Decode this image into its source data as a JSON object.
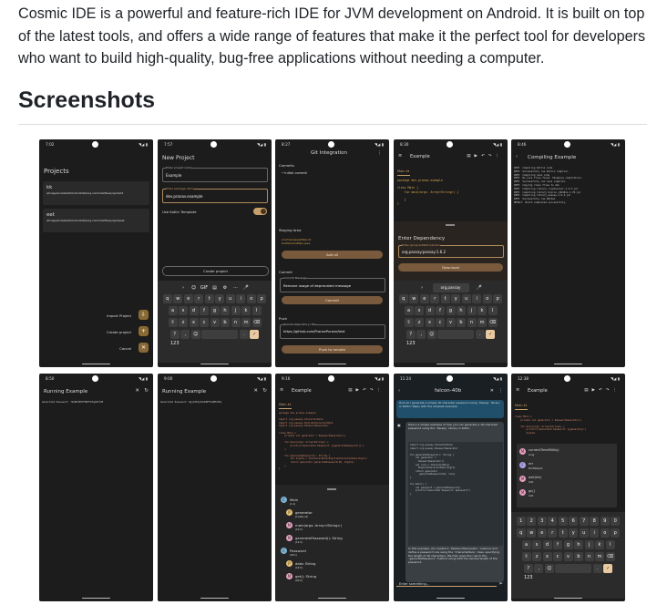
{
  "intro": "Cosmic IDE is a powerful and feature-rich IDE for JVM development on Android. It is built on top of the latest tools, and offers a wide range of features that make it the perfect tool for developers who want to build high-quality, bug-free applications without needing a computer.",
  "section_title": "Screenshots",
  "colors": {
    "accent": "#b08a5a",
    "dark": "#1c1c1c"
  },
  "icons": {
    "signal": "◥◢ ▮"
  },
  "shots": [
    {
      "time": "7:02",
      "title": "Projects",
      "projects": [
        {
          "name": "kk",
          "path": "/storage/emulated/0/Android/data/org.cosmicide/files/projects/kk"
        },
        {
          "name": "eet",
          "path": "/storage/emulated/0/Android/data/org.cosmicide/files/projects/eet"
        }
      ],
      "actions": [
        "Import Project",
        "Create project",
        "Cancel"
      ]
    },
    {
      "time": "7:57",
      "title": "New Project",
      "name_label": "Enter project name",
      "name_value": "Example",
      "pkg_label": "Enter package name",
      "pkg_value": "dev.pranav.example",
      "kotlin_label": "Use Kotlin Template",
      "create_label": "Create project"
    },
    {
      "time": "8:27",
      "title": "Git Integration",
      "commits_label": "Commits",
      "commit_item": "• Initial commit",
      "staging_label": "Staging Area",
      "staging_files": "src/main/java/Main.kt\nbuild/main/Main.java",
      "add_all": "Add all",
      "commit_label": "Commit",
      "commit_msg_label": "Commit Message",
      "commit_msg": "Remove usage of deprecated message",
      "commit_btn": "Commit",
      "push_label": "Push",
      "remote_label": "Remote Repository URL",
      "remote_url": "https://github.com/PranavPurwar/test",
      "push_btn": "Push to remote"
    },
    {
      "time": "8:30",
      "title": "Example",
      "tab": "Main.kt",
      "dep_title": "Enter Dependency",
      "dep_label": "Enter group:artifact:version",
      "dep_value": "org.passay:passay:1.6.2",
      "download": "Download",
      "suggestion": "org.passay"
    },
    {
      "time": "8:46",
      "title": "Compiling Example",
      "log": "INFO  Compiling Kotlin code\nINFO  Successfully ran Kotlin compiler.\nINFO  Compiling Java code\nINFO  No java files found. Skipping compilation.\nINFO  Successfully ran Java compiler.\nINFO  Copying class files to dex\nINFO  Compiling library cryptacular-1.2.5.jar\nINFO  Compiling library bcprov-jdk18on-1.76.jar\nINFO  Compiling library passay-1.6.2.jar\nINFO  Successfully ran D8/dex\nRESULT  Build completed successfully."
    },
    {
      "time": "8:50",
      "title": "Running Example",
      "output": "Generated Password: 7b4HhhE87F6M7FkFgmU7C9E"
    },
    {
      "time": "9:00",
      "title": "Running Example",
      "output": "Generated Password: Dgjh2XVyG4nbBF5Tq8Mc85q"
    },
    {
      "time": "9:16",
      "title": "Example",
      "tab": "Main.kt",
      "code": "package dev.pranav.example\n\nimport org.passay.CharacterRule\nimport org.passay.EnglishCharacterData\nimport org.passay.PasswordGenerator\n\nclass Main {\n    private val generator = PasswordGenerator()\n\n    fun main(args: Array<String>) {\n        println(\"Generated Password: ${generatePassword()}\")\n    }\n\n    fun generatePassword(): String {\n        val digits = CharacterRule(EnglishCharacterData.Digit)\n        return generator.generatePassword(20, digits)\n    }\n}",
      "outline": [
        {
          "kind": "C",
          "name": "Main",
          "line": "(1:1)"
        },
        {
          "kind": "P",
          "name": "generator",
          "line": "private val"
        },
        {
          "kind": "M",
          "name": "main(args: Array<String>)",
          "line": "(10:3)"
        },
        {
          "kind": "M",
          "name": "generatePassword(): String",
          "line": "(14:3)"
        },
        {
          "kind": "C",
          "name": "Password",
          "line": "(18:1)"
        },
        {
          "kind": "P",
          "name": "data: String",
          "line": "(19:5)"
        },
        {
          "kind": "M",
          "name": "get(): String",
          "line": "(20:5)"
        }
      ]
    },
    {
      "time": "11:24",
      "title": "falcon-40b",
      "user_msg": "How do I generate a simple 16 character password using `Passay` library in Kotlin? Reply with the simplest example.",
      "bot_intro": "Here's a simple example of how you can generate a 16-character password using the `Passay` library in Kotlin:",
      "bot_code": "import org.passay.CharacterRule\nimport org.passay.PasswordGenerator\n\nfun generatePassword(): String {\n    val generator =\n      PasswordGenerator()\n    val rule = CharacterRule(\n      EnglishCharacterData.Digit)\n    return generator\n      .generatePassword(16, rule)\n}\n\nfun main() {\n    val password = generatePassword()\n    println(\"Generated Password: $password\")\n}",
      "bot_outro": "In this example, we created a `PasswordGenerator` instance and define a password rule using the `CharacterRule` class, specifying the length of 16 characters. We then pass this rule to the `generatePassword` method along with the desired length of the password.",
      "placeholder": "Enter something..."
    },
    {
      "time": "12:38",
      "title": "Example",
      "tab": "Main.kt",
      "code": "class Main {\n    private val generator = PasswordGenerator()\n\n    fun main(args: Array<String>) {\n        println(\"Generated Password: ${generate}\")\n        System.",
      "completions": [
        {
          "kind": "M",
          "name": "currentTimeMillis()",
          "type": "Long"
        },
        {
          "kind": "F",
          "name": "err",
          "type": "PrintStream"
        },
        {
          "kind": "M",
          "name": "exit(Int)",
          "type": "Unit"
        },
        {
          "kind": "M",
          "name": "gc()",
          "type": "Unit"
        }
      ],
      "number_row": [
        "1",
        "2",
        "3",
        "4",
        "5",
        "6",
        "7",
        "8",
        "9",
        "0"
      ]
    }
  ],
  "keyboard": {
    "row1": [
      "q",
      "w",
      "e",
      "r",
      "t",
      "y",
      "u",
      "i",
      "o",
      "p"
    ],
    "row2": [
      "a",
      "s",
      "d",
      "f",
      "g",
      "h",
      "j",
      "k",
      "l"
    ],
    "row3": [
      "⇧",
      "z",
      "x",
      "c",
      "v",
      "b",
      "n",
      "m",
      "⌫"
    ],
    "row4": [
      "?123",
      ",",
      "☺",
      " ",
      ".",
      "✓"
    ]
  }
}
